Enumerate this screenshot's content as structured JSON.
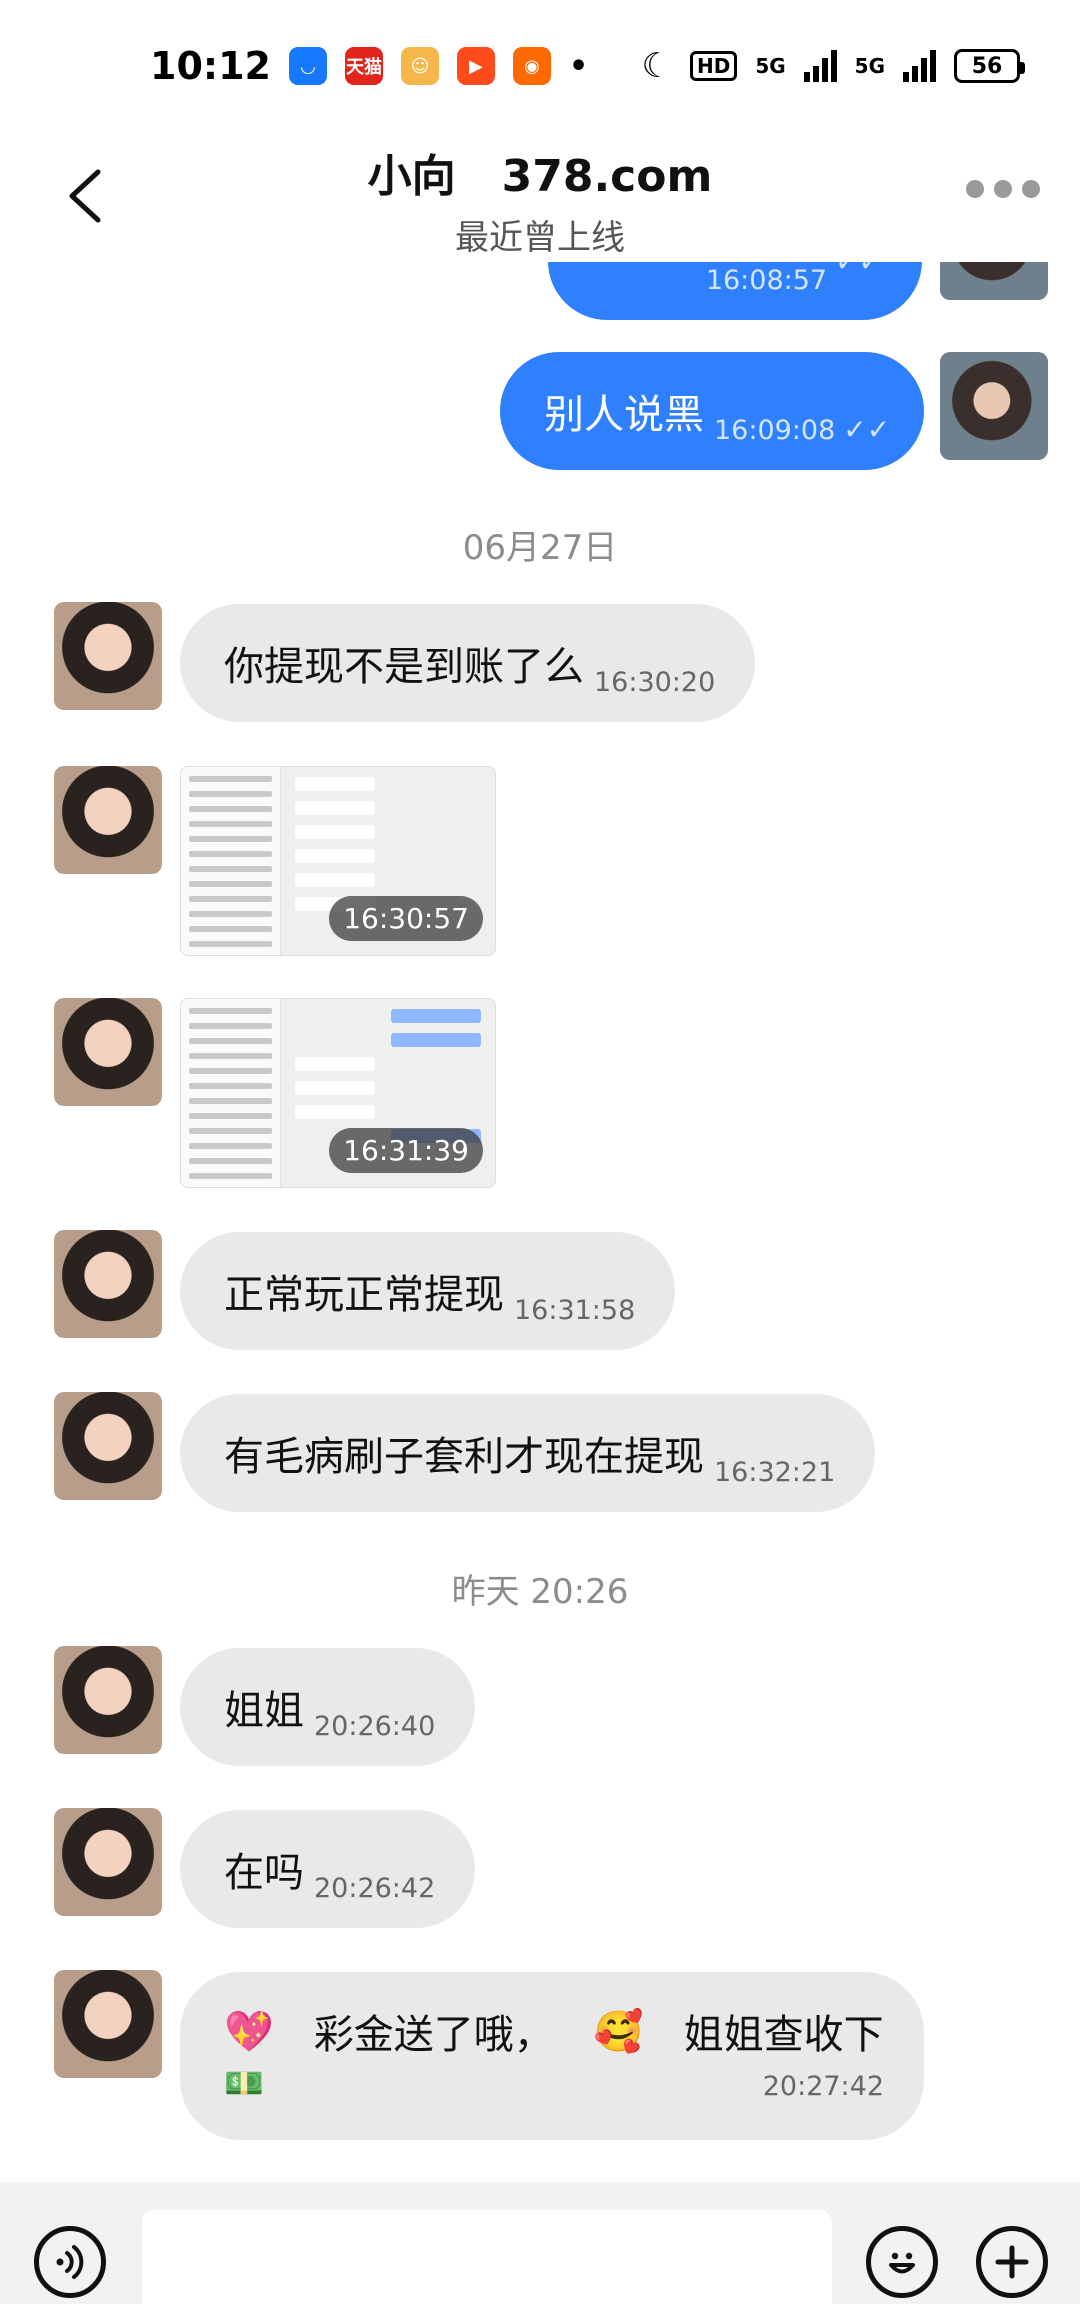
{
  "status": {
    "time": "10:12",
    "hd": "HD",
    "net1": "5G",
    "net2": "5G",
    "battery": "56",
    "apps": [
      {
        "icon": "alipay-icon",
        "label": "",
        "color": "#1677ff"
      },
      {
        "icon": "tmall-icon",
        "label": "天猫",
        "color": "#e1251b"
      },
      {
        "icon": "mascot-app-icon",
        "label": "",
        "color": "#f6b74a"
      },
      {
        "icon": "video-play-icon",
        "label": "",
        "color": "#ff4a1c"
      },
      {
        "icon": "kuaishou-icon",
        "label": "",
        "color": "#ff6a00"
      }
    ]
  },
  "header": {
    "title": "小向   378.com",
    "subtitle": "最近曾上线"
  },
  "messages": {
    "m0": {
      "time": "16:08:57"
    },
    "m1": {
      "text": "别人说黑",
      "time": "16:09:08"
    },
    "sep1": "06月27日",
    "m2": {
      "text": "你提现不是到账了么",
      "time": "16:30:20"
    },
    "m3": {
      "time": "16:30:57"
    },
    "m4": {
      "time": "16:31:39"
    },
    "m5": {
      "text": "正常玩正常提现",
      "time": "16:31:58"
    },
    "m6": {
      "text": "有毛病刷子套利才现在提现",
      "time": "16:32:21"
    },
    "sep2": "昨天 20:26",
    "m7": {
      "text": "姐姐",
      "time": "20:26:40"
    },
    "m8": {
      "text": "在吗",
      "time": "20:26:42"
    },
    "m9": {
      "line1a": "彩金送了哦，",
      "line1b": "姐姐查收下",
      "time": "20:27:42"
    }
  },
  "colors": {
    "outgoing_bubble": "#2f80ff",
    "incoming_bubble": "#e9e9e9"
  }
}
